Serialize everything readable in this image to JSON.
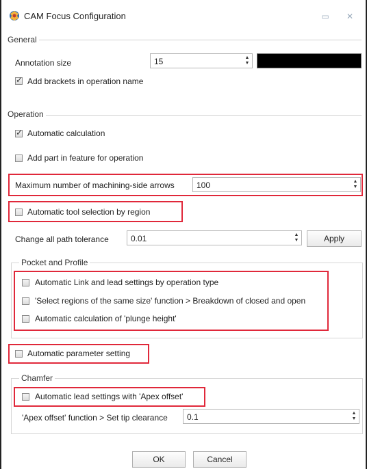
{
  "window": {
    "title": "CAM Focus Configuration",
    "icons": {
      "app": "app-icon",
      "restore": "restore-icon",
      "close": "close-icon"
    }
  },
  "general": {
    "legend": "General",
    "annotation_size_label": "Annotation size",
    "annotation_size_value": "15",
    "annotation_color": "#000000",
    "add_brackets_label": "Add brackets in operation name",
    "add_brackets_checked": true
  },
  "operation": {
    "legend": "Operation",
    "auto_calc_label": "Automatic calculation",
    "auto_calc_checked": true,
    "add_part_label": "Add part in feature for operation",
    "add_part_checked": false,
    "max_arrows_label": "Maximum number of machining-side arrows",
    "max_arrows_value": "100",
    "auto_tool_label": "Automatic tool selection by region",
    "auto_tool_checked": false,
    "path_tol_label": "Change all path tolerance",
    "path_tol_value": "0.01",
    "apply_label": "Apply"
  },
  "pocket_profile": {
    "legend": "Pocket and Profile",
    "items": [
      {
        "label": "Automatic Link and lead settings by operation type",
        "checked": false
      },
      {
        "label": "'Select regions of the same size' function > Breakdown of closed and open",
        "checked": false
      },
      {
        "label": "Automatic calculation of 'plunge height'",
        "checked": false
      }
    ]
  },
  "auto_param_label": "Automatic parameter setting",
  "auto_param_checked": false,
  "chamfer": {
    "legend": "Chamfer",
    "apex_lead_label": "Automatic lead settings with 'Apex offset'",
    "apex_lead_checked": false,
    "tip_clearance_label": "'Apex offset' function > Set tip clearance",
    "tip_clearance_value": "0.1"
  },
  "buttons": {
    "ok": "OK",
    "cancel": "Cancel"
  },
  "colors": {
    "highlight": "#e0283a"
  }
}
